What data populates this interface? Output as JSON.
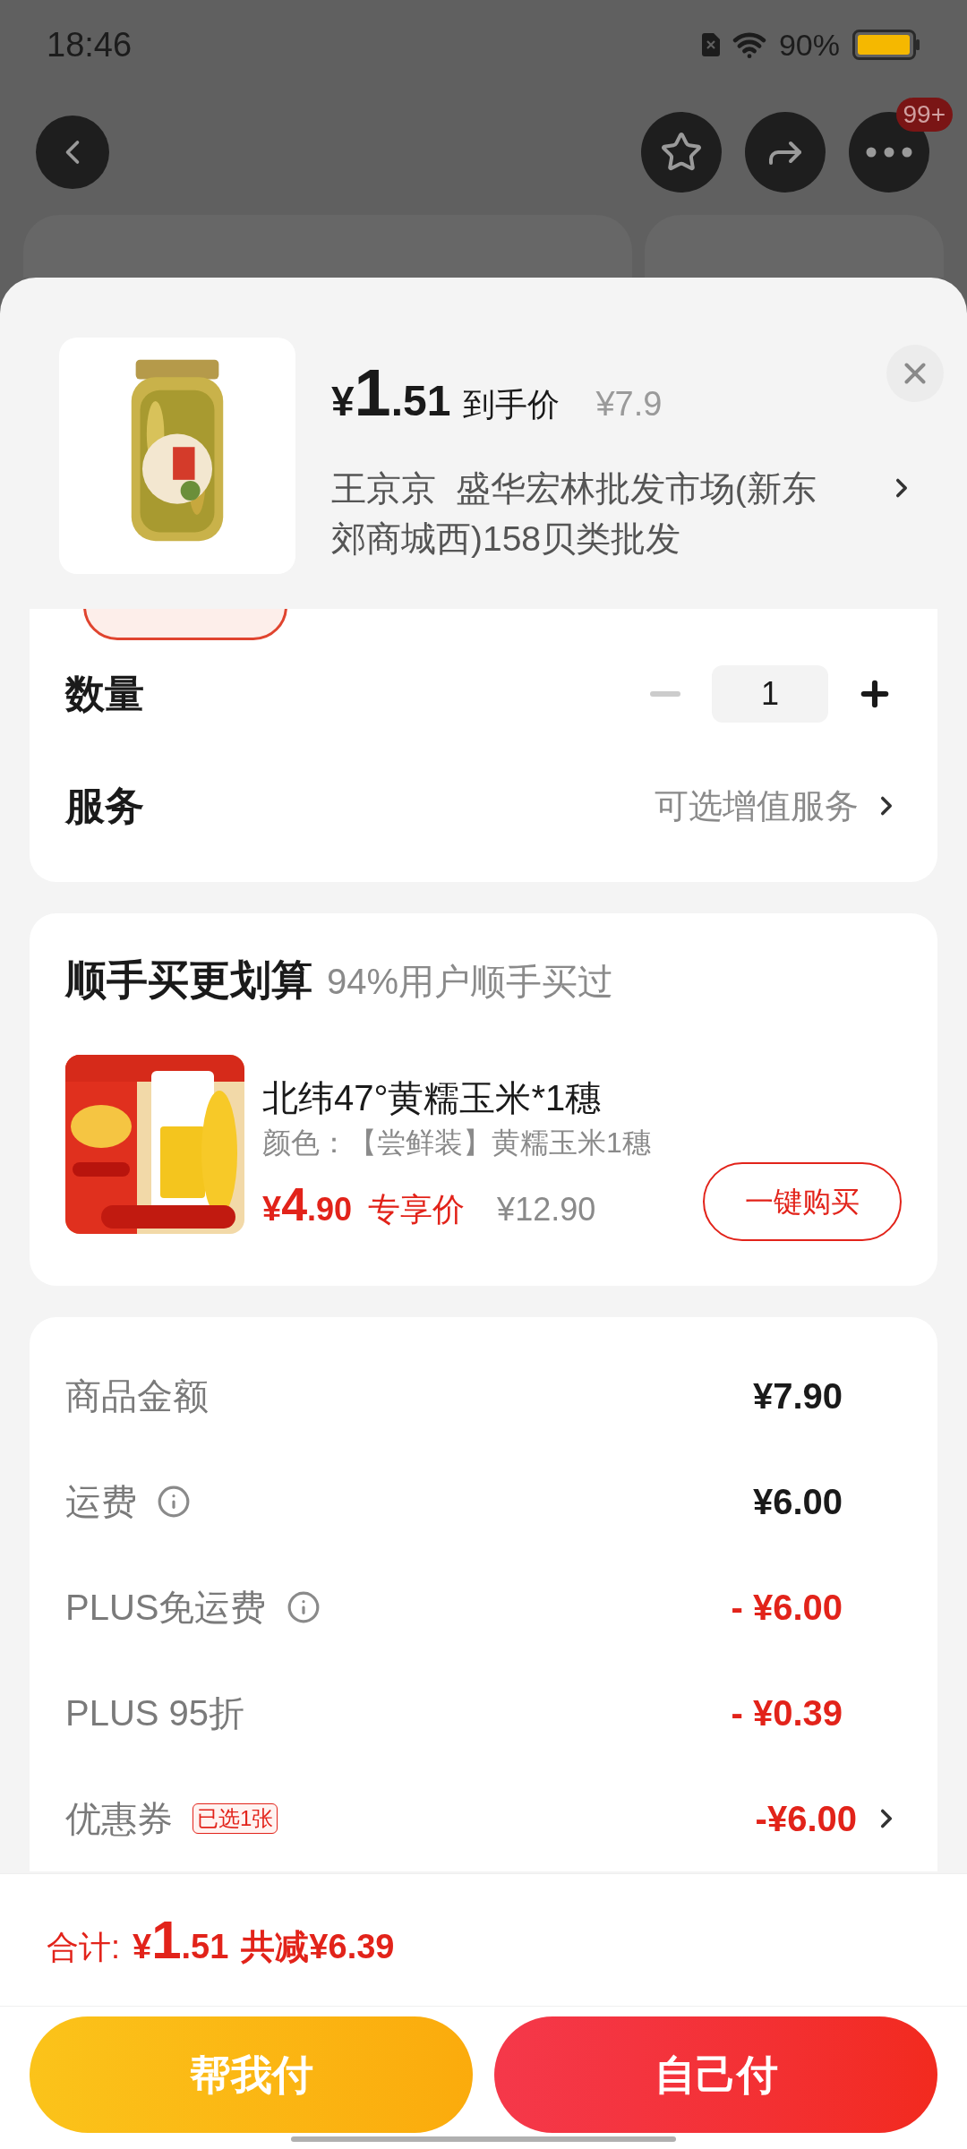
{
  "status_bar": {
    "time": "18:46",
    "battery": "90%"
  },
  "nav": {
    "badge": "99+"
  },
  "product": {
    "price_symbol": "¥",
    "price_integer": "1",
    "price_decimal": ".51",
    "price_label": "到手价",
    "original_price": "¥7.9",
    "shop": "王京京  盛华宏林批发市场(新东郊商城西)158贝类批发"
  },
  "quantity": {
    "label": "数量",
    "value": "1",
    "decrease_disabled": true
  },
  "service": {
    "label": "服务",
    "value": "可选增值服务"
  },
  "bundle": {
    "title": "顺手买更划算",
    "subtitle": "94%用户顺手买过",
    "item": {
      "name": "北纬47°黄糯玉米*1穗",
      "variant": "颜色：【尝鲜装】黄糯玉米1穗",
      "price_symbol": "¥",
      "price_integer": "4",
      "price_decimal": ".90",
      "price_label": "专享价",
      "original_price": "¥12.90",
      "button": "一键购买"
    }
  },
  "breakdown": [
    {
      "label": "商品金额",
      "value": "¥7.90",
      "kind": "charge",
      "info": false
    },
    {
      "label": "运费",
      "value": "¥6.00",
      "kind": "charge",
      "info": true
    },
    {
      "label": "PLUS免运费",
      "value": "- ¥6.00",
      "kind": "discount",
      "info": true
    },
    {
      "label": "PLUS 95折",
      "value": "- ¥0.39",
      "kind": "discount",
      "info": false
    },
    {
      "label": "优惠券",
      "tag": "已选1张",
      "value": "-¥6.00",
      "kind": "discount",
      "info": false,
      "link": true
    }
  ],
  "total": {
    "label": "合计:",
    "symbol": "¥",
    "integer": "1",
    "decimal": ".51",
    "savings": "共减¥6.39"
  },
  "buttons": [
    {
      "label": "帮我付",
      "kind": "secondary"
    },
    {
      "label": "自己付",
      "kind": "primary"
    }
  ]
}
